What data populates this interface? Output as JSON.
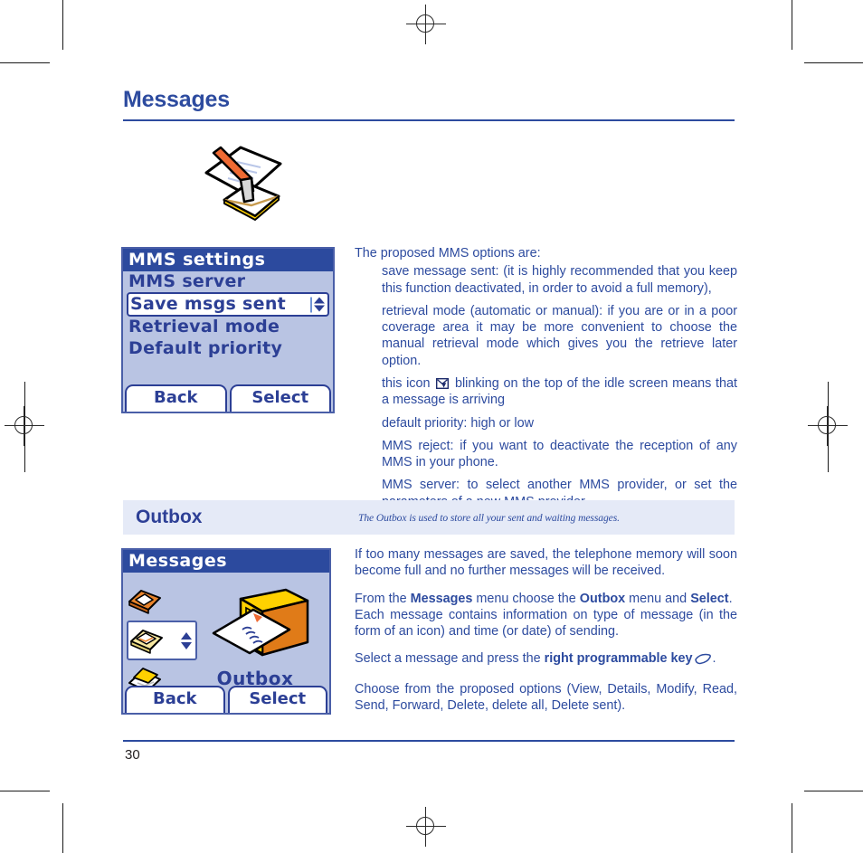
{
  "document": {
    "title": "Messages",
    "page_number": "30"
  },
  "mms_screen": {
    "title": "MMS settings",
    "rows": [
      {
        "label": "MMS server",
        "selected": false
      },
      {
        "label": "Save msgs sent",
        "selected": true
      },
      {
        "label": "Retrieval mode",
        "selected": false
      },
      {
        "label": "Default priority",
        "selected": false
      }
    ],
    "softkeys": {
      "left": "Back",
      "right": "Select"
    }
  },
  "mms_text": {
    "lead": "The proposed MMS options are:",
    "bullets": [
      "save message sent: (it is highly recommended that you keep this function deactivated, in order to avoid a full memory),",
      "retrieval mode (automatic or manual): if you are or in a poor coverage area it may be more convenient to choose the manual retrieval mode which gives you the retrieve later option.",
      "default priority: high or low",
      "MMS reject: if you want to deactivate the reception of any MMS in your phone.",
      "MMS server: to select another MMS provider, or set the parameters of a new MMS provider."
    ],
    "icon_bullet_before": "this icon",
    "icon_bullet_after": "blinking on the top of the idle screen means that a message is arriving"
  },
  "outbox_section": {
    "heading": "Outbox",
    "note": "The Outbox is used to store all your sent and waiting messages.",
    "paragraphs": {
      "p1": "If too many messages are saved, the telephone memory will soon become full and no further messages will be received.",
      "p2_a": "From the ",
      "p2_b": "Messages",
      "p2_c": " menu choose the ",
      "p2_d": "Outbox",
      "p2_e": " menu and ",
      "p2_f": "Select",
      "p2_g": ".",
      "p3": "Each message contains information on type of message (in the form of an icon) and time (or date) of sending.",
      "p4_a": "Select a message and press the ",
      "p4_b": "right programmable key",
      "p4_c": ".",
      "p5": "Choose from the proposed options (View, Details, Modify, Read, Send, Forward, Delete, delete all, Delete sent)."
    }
  },
  "outbox_screen": {
    "title": "Messages",
    "caption": "Outbox",
    "softkeys": {
      "left": "Back",
      "right": "Select"
    }
  },
  "colors": {
    "brand_blue": "#2d4b9f",
    "screen_title_bg": "#2c4a9e",
    "screen_body_bg": "#b9c4e3",
    "band_bg": "#e5eaf7"
  }
}
